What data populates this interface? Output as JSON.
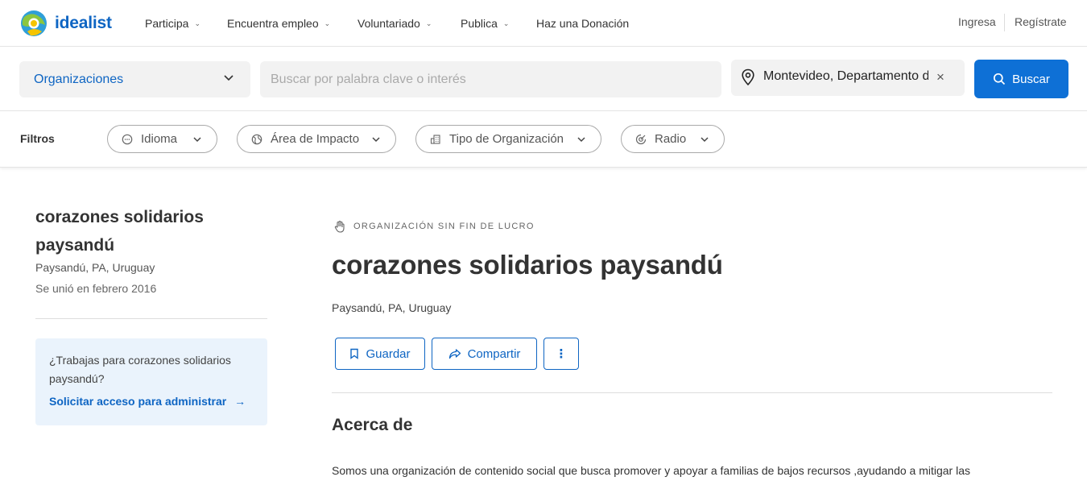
{
  "brand": {
    "name": "idealist",
    "logo_icon": "idealist-globe-logo",
    "primary_color": "#0e65c3",
    "button_color": "#0e70d6"
  },
  "nav": {
    "items": [
      {
        "label": "Participa",
        "has_dropdown": true
      },
      {
        "label": "Encuentra empleo",
        "has_dropdown": true
      },
      {
        "label": "Voluntariado",
        "has_dropdown": true
      },
      {
        "label": "Publica",
        "has_dropdown": true
      },
      {
        "label": "Haz una Donación",
        "has_dropdown": false
      }
    ],
    "login": "Ingresa",
    "signup": "Regístrate"
  },
  "search": {
    "category": "Organizaciones",
    "keyword_placeholder": "Buscar por palabra clave o interés",
    "keyword_value": "",
    "location_value": "Montevideo, Departamento de Montevideo, Uruguay",
    "clear_symbol": "×",
    "button_label": "Buscar"
  },
  "filters": {
    "label": "Filtros",
    "chips": [
      {
        "label": "Idioma",
        "icon": "chat-bubble-icon"
      },
      {
        "label": "Área de Impacto",
        "icon": "globe-icon"
      },
      {
        "label": "Tipo de Organización",
        "icon": "building-icon"
      },
      {
        "label": "Radio",
        "icon": "radius-icon"
      }
    ]
  },
  "sidebar": {
    "org_name": "corazones solidarios paysandú",
    "location": "Paysandú, PA, Uruguay",
    "joined": "Se unió en febrero 2016",
    "claim_question": "¿Trabajas para corazones solidarios paysandú?",
    "claim_link": "Solicitar acceso para administrar",
    "claim_arrow": "→"
  },
  "main": {
    "type_label": "ORGANIZACIÓN SIN FIN DE LUCRO",
    "type_icon": "hand-icon",
    "title": "corazones solidarios paysandú",
    "location": "Paysandú, PA, Uruguay",
    "actions": {
      "save": "Guardar",
      "share": "Compartir",
      "more": "⋮"
    },
    "about_heading": "Acerca de",
    "about_text": "Somos una organización de contenido social que busca promover y apoyar a familias de bajos recursos ,ayudando a mitigar las"
  }
}
